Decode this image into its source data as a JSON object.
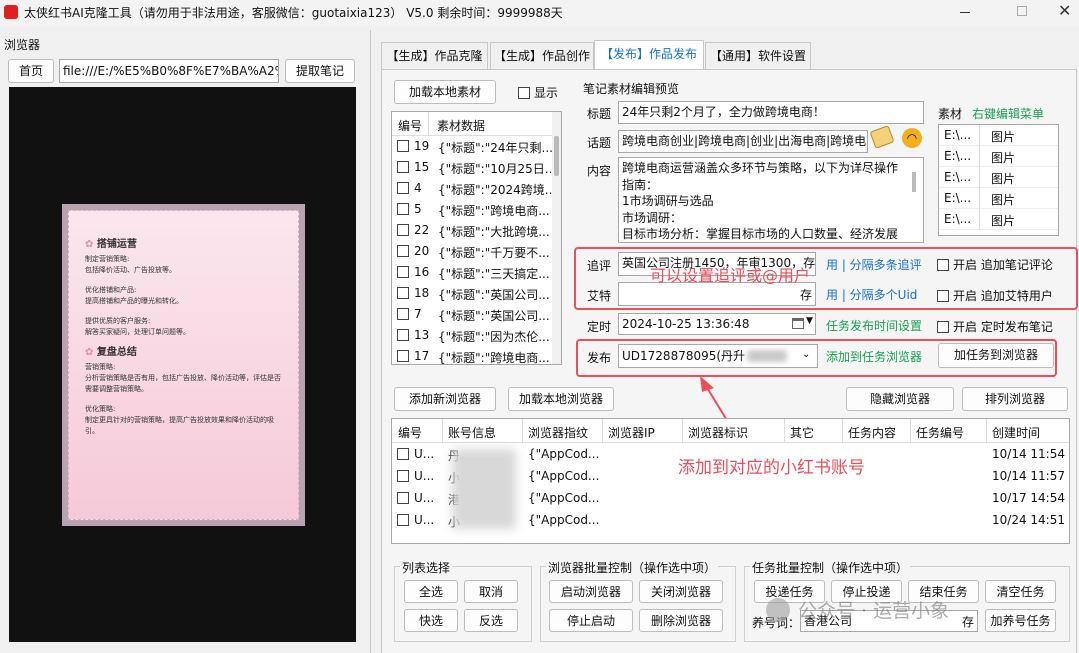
{
  "window": {
    "title": "太侠红书AI克隆工具（请勿用于非法用途，客服微信：guotaixia123） V5.0 剩余时间：9999988天"
  },
  "left": {
    "section_title": "浏览器",
    "home_button": "首页",
    "url_value": "file:///E:/%E5%B0%8F%E7%BA%A2%E",
    "extract_button": "提取笔记",
    "preview": {
      "h1": "搭铺运营",
      "p1": "制定营销策略:",
      "p2": "包括降价活动、广告投放等。",
      "p3": "优化搭铺和产品:",
      "p4": "提高搭铺和产品的曝光和转化。",
      "p5": "提供优质的客户服务:",
      "p6": "解答买家疑问，处理订单问题等。",
      "h2": "复盘总结",
      "p7": "营销策略:",
      "p8": "分析营销策略是否有用，包括广告投放、降价活动等，评估是否需要调整营销策略。",
      "p9": "优化策略:",
      "p10": "制定更具针对的营销策略，提高广告投放效果和降价活动的吸引。"
    }
  },
  "tabs": [
    "【生成】作品克隆",
    "【生成】作品创作",
    "【发布】作品发布",
    "【通用】软件设置"
  ],
  "material": {
    "load_button": "加载本地素材",
    "show_label": "显示",
    "col_num": "编号",
    "col_data": "素材数据",
    "rows": [
      {
        "num": "19",
        "data": "{\"标题\":\"24年只剩..."
      },
      {
        "num": "15",
        "data": "{\"标题\":\"10月25日..."
      },
      {
        "num": "4",
        "data": "{\"标题\":\"2024跨境..."
      },
      {
        "num": "5",
        "data": "{\"标题\":\"跨境电商..."
      },
      {
        "num": "22",
        "data": "{\"标题\":\"大批跨境..."
      },
      {
        "num": "20",
        "data": "{\"标题\":\"千万要不..."
      },
      {
        "num": "16",
        "data": "{\"标题\":\"三天搞定..."
      },
      {
        "num": "18",
        "data": "{\"标题\":\"英国公司..."
      },
      {
        "num": "7",
        "data": "{\"标题\":\"英国公司..."
      },
      {
        "num": "13",
        "data": "{\"标题\":\"因为杰伦..."
      },
      {
        "num": "17",
        "data": "{\"标题\":\"跨境电商..."
      }
    ]
  },
  "editor": {
    "section_title": "笔记素材编辑预览",
    "title_label": "标题",
    "title_value": "24年只剩2个月了，全力做跨境电商！",
    "topic_label": "话题",
    "topic_value": "跨境电商创业|跨境电商|创业|出海电商|跨境电商",
    "content_label": "内容",
    "content_lines": [
      "跨境电商运营涵盖众多环节与策略，以下为详尽操作",
      "指南：",
      "1市场调研与选品",
      "市场调研：",
      "目标市场分析：掌握目标市场的人口数量、经济发展"
    ],
    "media_label": "素材",
    "media_menu": "右键编辑菜单",
    "media_rows": [
      {
        "path": "E:\\...",
        "type": "图片"
      },
      {
        "path": "E:\\...",
        "type": "图片"
      },
      {
        "path": "E:\\...",
        "type": "图片"
      },
      {
        "path": "E:\\...",
        "type": "图片"
      },
      {
        "path": "E:\\...",
        "type": "图片"
      }
    ],
    "comment_label": "追评",
    "comment_value": "英国公司注册1450，年审1300，存",
    "comment_link": "用 | 分隔多条追评",
    "comment_toggle": "开启 追加笔记评论",
    "at_label": "艾特",
    "at_save": "存",
    "at_link": "用 | 分隔多个Uid",
    "at_toggle": "开启 追加艾特用户",
    "schedule_label": "定时",
    "schedule_value": "2024-10-25 13:36:48",
    "schedule_link": "任务发布时间设置",
    "schedule_toggle": "开启 定时发布笔记",
    "publish_label": "发布",
    "publish_value": "UD1728878095(丹升",
    "publish_link": "添加到任务浏览器",
    "publish_button": "加任务到浏览器"
  },
  "annotations": {
    "a1": "可以设置追评或@用户",
    "a2": "添加到对应的小红书账号"
  },
  "browsers": {
    "add_button": "添加新浏览器",
    "load_button": "加载本地浏览器",
    "hide_button": "隐藏浏览器",
    "arrange_button": "排列浏览器",
    "columns": [
      "编号",
      "账号信息",
      "浏览器指纹",
      "浏览器IP",
      "浏览器标识",
      "其它",
      "任务内容",
      "任务编号",
      "创建时间"
    ],
    "rows": [
      {
        "num": "U...",
        "acct": "丹",
        "fp": "{\"AppCod...",
        "time": "10/14 11:54"
      },
      {
        "num": "U...",
        "acct": "小",
        "fp": "{\"AppCod...",
        "time": "10/14 11:57"
      },
      {
        "num": "U...",
        "acct": "港",
        "fp": "{\"AppCod...",
        "time": "10/17 14:54"
      },
      {
        "num": "U...",
        "acct": "小",
        "fp": "{\"AppCod...",
        "time": "10/24 14:51"
      }
    ]
  },
  "list_select": {
    "title": "列表选择",
    "all": "全选",
    "cancel": "取消",
    "quick": "快选",
    "invert": "反选"
  },
  "batch_browser": {
    "title": "浏览器批量控制（操作选中项）",
    "start": "启动浏览器",
    "close": "关闭浏览器",
    "stop": "停止启动",
    "delete": "删除浏览器"
  },
  "batch_task": {
    "title": "任务批量控制（操作选中项）",
    "deliver": "投递任务",
    "stop": "停止投递",
    "end": "结束任务",
    "clear": "清空任务",
    "keyword_label": "养号词：",
    "keyword_value": "香港公司",
    "save": "存",
    "add": "加养号任务"
  },
  "watermark": "公众号 · 运营小象",
  "colors": {
    "accent": "#1a6fd0",
    "annotation": "#e8505b"
  }
}
